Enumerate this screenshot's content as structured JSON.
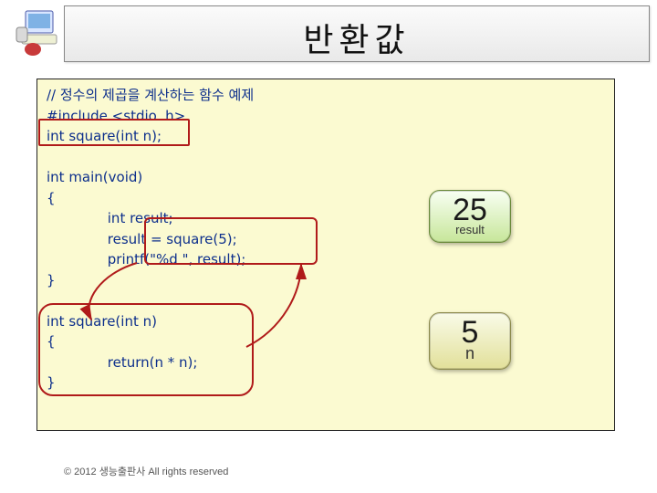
{
  "title": "반환값",
  "code": {
    "comment": "// 정수의 제곱을 계산하는 함수 예제",
    "include": "#include <stdio. h>",
    "prototype": "int square(int n);",
    "main_sig": "int main(void)",
    "brace_open": "{",
    "decl": "int result;",
    "assign": "result = square(5);",
    "printf": "printf(\"%d \", result);",
    "brace_close": "}",
    "func_sig": "int square(int n)",
    "func_open": "{",
    "return": "return(n * n);",
    "func_close": "}"
  },
  "box25": {
    "value": "25",
    "label": "result"
  },
  "box5": {
    "value": "5",
    "label": "n"
  },
  "footer": "© 2012 생능출판사  All rights reserved"
}
